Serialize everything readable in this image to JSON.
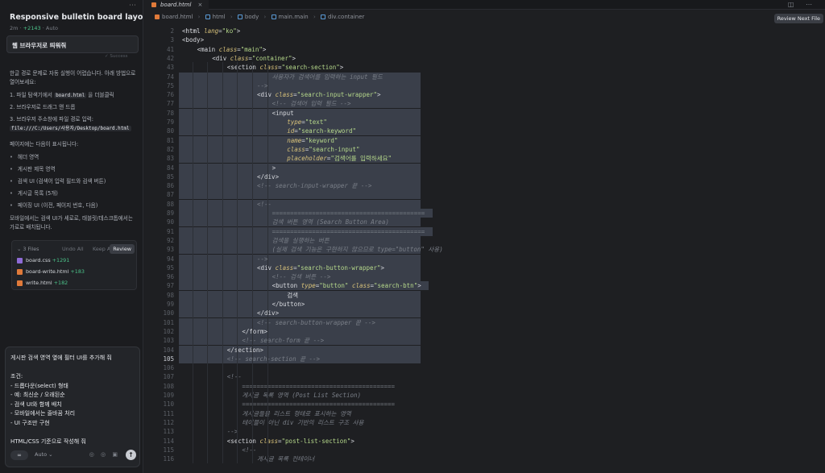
{
  "chat": {
    "title": "Responsive bulletin board layout",
    "meta_time": "2m",
    "meta_added": "+2143",
    "meta_mode": "Auto",
    "user_message": "웹 브라우저로 띄워줘",
    "success_label": "Success",
    "para1": "한글 경로 문제로 자동 실행이 어렵습니다. 아래 방법으로 열어보세요:",
    "steps": [
      {
        "num": "1.",
        "pre": "파일 탐색기에서 ",
        "code": "board.html",
        "post": " 을 더블클릭"
      },
      {
        "num": "2.",
        "pre": "브라우저로 드래그 앤 드롭",
        "code": "",
        "post": ""
      },
      {
        "num": "3.",
        "pre": "브라우저 주소창에 파일 경로 입력: ",
        "code": "file:///C:/Users/사용자/Desktop/board.html",
        "post": ""
      }
    ],
    "para2": "페이지에는 다음이 표시됩니다:",
    "bullets": [
      "헤더 영역",
      "게시판 제목 영역",
      "검색 UI (검색어 입력 필드와 검색 버튼)",
      "게시글 목록 (5개)",
      "페이징 UI (이전, 페이지 번호, 다음)"
    ],
    "para3": "모바일에서는 검색 UI가 세로로, 태블릿/데스크톱에서는 가로로 배치됩니다.",
    "files": {
      "count_label": "3 Files",
      "undo_all": "Undo All",
      "keep_all": "Keep All",
      "review": "Review",
      "items": [
        {
          "name": "board.css",
          "added": "+1291",
          "kind": "css"
        },
        {
          "name": "board-write.html",
          "added": "+183",
          "kind": "html"
        },
        {
          "name": "write.html",
          "added": "+182",
          "kind": "html"
        }
      ]
    },
    "composer_text": "게시판 검색 영역 옆에 필터 UI를 추가해 줘\n\n조건:\n- 드롭다운(select) 형태\n- 예: 최신순 / 오래된순\n- 검색 UI와 함께 배치\n- 모바일에서는 줄바꿈 처리\n- UI 구조만 구현\n\nHTML/CSS 기준으로 작성해 줘",
    "composer_mode": "∞",
    "composer_auto": "Auto ⌄",
    "composer_icons": "◎ ◎ ▣",
    "composer_send": "↑"
  },
  "editor": {
    "tab_name": "board.html",
    "tab_close": "×",
    "tab_actions": "◫ ⋯",
    "breadcrumb": [
      "board.html",
      "html",
      "body",
      "main.main",
      "div.container"
    ],
    "review_next": "Review Next File",
    "current_line": "105"
  },
  "code_lines": [
    {
      "n": "2",
      "i": 0,
      "hl": false,
      "parts": [
        [
          "t",
          "<"
        ],
        [
          "tag",
          "html"
        ],
        [
          "t",
          " "
        ],
        [
          "attr",
          "lang"
        ],
        [
          "t",
          "="
        ],
        [
          "str",
          "\"ko\""
        ],
        [
          "t",
          ">"
        ]
      ]
    },
    {
      "n": "3",
      "i": 0,
      "hl": false,
      "parts": [
        [
          "t",
          "<body>"
        ]
      ]
    },
    {
      "n": "41",
      "i": 1,
      "hl": false,
      "parts": [
        [
          "t",
          "<main "
        ],
        [
          "attr",
          "class"
        ],
        [
          "t",
          "="
        ],
        [
          "str",
          "\"main\""
        ],
        [
          "t",
          ">"
        ]
      ]
    },
    {
      "n": "42",
      "i": 2,
      "hl": false,
      "parts": [
        [
          "t",
          "<div "
        ],
        [
          "attr",
          "class"
        ],
        [
          "t",
          "="
        ],
        [
          "str",
          "\"container\""
        ],
        [
          "t",
          ">"
        ]
      ]
    },
    {
      "n": "43",
      "i": 3,
      "hl": false,
      "parts": [
        [
          "t",
          "<section "
        ],
        [
          "attr",
          "class"
        ],
        [
          "t",
          "="
        ],
        [
          "str",
          "\"search-section\""
        ],
        [
          "t",
          ">"
        ]
      ]
    },
    {
      "n": "74",
      "i": 6,
      "hl": true,
      "parts": [
        [
          "cm",
          "사용자가 검색어를 입력하는 input 필드"
        ]
      ]
    },
    {
      "n": "75",
      "i": 5,
      "hl": true,
      "parts": [
        [
          "cm",
          "-->"
        ]
      ]
    },
    {
      "n": "76",
      "i": 5,
      "hl": true,
      "parts": [
        [
          "t",
          "<div "
        ],
        [
          "attr",
          "class"
        ],
        [
          "t",
          "="
        ],
        [
          "str",
          "\"search-input-wrapper\""
        ],
        [
          "t",
          ">"
        ]
      ]
    },
    {
      "n": "77",
      "i": 6,
      "hl": true,
      "parts": [
        [
          "cm",
          "<!-- 검색어 입력 필드 -->"
        ]
      ]
    },
    {
      "n": "78",
      "i": 6,
      "hl": true,
      "parts": [
        [
          "t",
          "<input"
        ]
      ]
    },
    {
      "n": "79",
      "i": 7,
      "hl": true,
      "parts": [
        [
          "attr",
          "type"
        ],
        [
          "t",
          "="
        ],
        [
          "str",
          "\"text\""
        ]
      ]
    },
    {
      "n": "80",
      "i": 7,
      "hl": true,
      "parts": [
        [
          "attr",
          "id"
        ],
        [
          "t",
          "="
        ],
        [
          "str",
          "\"search-keyword\""
        ]
      ]
    },
    {
      "n": "81",
      "i": 7,
      "hl": true,
      "parts": [
        [
          "attr",
          "name"
        ],
        [
          "t",
          "="
        ],
        [
          "str",
          "\"keyword\""
        ]
      ]
    },
    {
      "n": "82",
      "i": 7,
      "hl": true,
      "parts": [
        [
          "attr",
          "class"
        ],
        [
          "t",
          "="
        ],
        [
          "str",
          "\"search-input\""
        ]
      ]
    },
    {
      "n": "83",
      "i": 7,
      "hl": true,
      "parts": [
        [
          "attr",
          "placeholder"
        ],
        [
          "t",
          "="
        ],
        [
          "str",
          "\"검색어를 입력하세요\""
        ]
      ]
    },
    {
      "n": "84",
      "i": 6,
      "hl": true,
      "parts": [
        [
          "t",
          ">"
        ]
      ]
    },
    {
      "n": "85",
      "i": 5,
      "hl": true,
      "parts": [
        [
          "t",
          "</div>"
        ]
      ]
    },
    {
      "n": "86",
      "i": 5,
      "hl": true,
      "parts": [
        [
          "cm",
          "<!-- search-input-wrapper 끝 -->"
        ]
      ]
    },
    {
      "n": "87",
      "i": 5,
      "hl": true,
      "parts": [
        [
          "t",
          ""
        ]
      ]
    },
    {
      "n": "88",
      "i": 5,
      "hl": true,
      "parts": [
        [
          "cm",
          "<!--"
        ]
      ]
    },
    {
      "n": "89",
      "i": 6,
      "hl": true,
      "parts": [
        [
          "cm",
          "=========================================="
        ]
      ]
    },
    {
      "n": "90",
      "i": 6,
      "hl": true,
      "parts": [
        [
          "cm",
          "검색 버튼 영역 (Search Button Area)"
        ]
      ]
    },
    {
      "n": "91",
      "i": 6,
      "hl": true,
      "parts": [
        [
          "cm",
          "=========================================="
        ]
      ]
    },
    {
      "n": "92",
      "i": 6,
      "hl": true,
      "parts": [
        [
          "cm",
          "검색을 실행하는 버튼"
        ]
      ]
    },
    {
      "n": "93",
      "i": 6,
      "hl": true,
      "parts": [
        [
          "cm",
          "(실제 검색 기능은 구현하지 않으므로 type=\"button\" 사용)"
        ]
      ]
    },
    {
      "n": "94",
      "i": 5,
      "hl": true,
      "parts": [
        [
          "cm",
          "-->"
        ]
      ]
    },
    {
      "n": "95",
      "i": 5,
      "hl": true,
      "parts": [
        [
          "t",
          "<div "
        ],
        [
          "attr",
          "class"
        ],
        [
          "t",
          "="
        ],
        [
          "str",
          "\"search-button-wrapper\""
        ],
        [
          "t",
          ">"
        ]
      ]
    },
    {
      "n": "96",
      "i": 6,
      "hl": true,
      "parts": [
        [
          "cm",
          "<!-- 검색 버튼 -->"
        ]
      ]
    },
    {
      "n": "97",
      "i": 6,
      "hl": true,
      "parts": [
        [
          "t",
          "<button "
        ],
        [
          "attr",
          "type"
        ],
        [
          "t",
          "="
        ],
        [
          "str",
          "\"button\""
        ],
        [
          "t",
          " "
        ],
        [
          "attr",
          "class"
        ],
        [
          "t",
          "="
        ],
        [
          "str",
          "\"search-btn\""
        ],
        [
          "t",
          ">"
        ]
      ]
    },
    {
      "n": "98",
      "i": 7,
      "hl": true,
      "parts": [
        [
          "t",
          "검색"
        ]
      ]
    },
    {
      "n": "99",
      "i": 6,
      "hl": true,
      "parts": [
        [
          "t",
          "</button>"
        ]
      ]
    },
    {
      "n": "100",
      "i": 5,
      "hl": true,
      "parts": [
        [
          "t",
          "</div>"
        ]
      ]
    },
    {
      "n": "101",
      "i": 5,
      "hl": true,
      "parts": [
        [
          "cm",
          "<!-- search-button-wrapper 끝 -->"
        ]
      ]
    },
    {
      "n": "102",
      "i": 4,
      "hl": true,
      "parts": [
        [
          "t",
          "</form>"
        ]
      ]
    },
    {
      "n": "103",
      "i": 4,
      "hl": true,
      "parts": [
        [
          "cm",
          "<!-- search-form 끝 -->"
        ]
      ]
    },
    {
      "n": "104",
      "i": 3,
      "hl": true,
      "parts": [
        [
          "t",
          "</section>"
        ]
      ]
    },
    {
      "n": "105",
      "i": 3,
      "hl": true,
      "parts": [
        [
          "cm",
          "<!-- search-section 끝 -->"
        ]
      ]
    },
    {
      "n": "106",
      "i": 0,
      "hl": false,
      "parts": [
        [
          "t",
          ""
        ]
      ]
    },
    {
      "n": "107",
      "i": 3,
      "hl": false,
      "parts": [
        [
          "cm",
          "<!--"
        ]
      ]
    },
    {
      "n": "108",
      "i": 4,
      "hl": false,
      "parts": [
        [
          "cm",
          "=========================================="
        ]
      ]
    },
    {
      "n": "109",
      "i": 4,
      "hl": false,
      "parts": [
        [
          "cm",
          "게시글 목록 영역 (Post List Section)"
        ]
      ]
    },
    {
      "n": "110",
      "i": 4,
      "hl": false,
      "parts": [
        [
          "cm",
          "=========================================="
        ]
      ]
    },
    {
      "n": "111",
      "i": 4,
      "hl": false,
      "parts": [
        [
          "cm",
          "게시글들을 리스트 형태로 표시하는 영역"
        ]
      ]
    },
    {
      "n": "112",
      "i": 4,
      "hl": false,
      "parts": [
        [
          "cm",
          "테이블이 아닌 div 기반의 리스트 구조 사용"
        ]
      ]
    },
    {
      "n": "113",
      "i": 3,
      "hl": false,
      "parts": [
        [
          "cm",
          "-->"
        ]
      ]
    },
    {
      "n": "114",
      "i": 3,
      "hl": false,
      "parts": [
        [
          "t",
          "<section "
        ],
        [
          "attr",
          "class"
        ],
        [
          "t",
          "="
        ],
        [
          "str",
          "\"post-list-section\""
        ],
        [
          "t",
          ">"
        ]
      ]
    },
    {
      "n": "115",
      "i": 4,
      "hl": false,
      "parts": [
        [
          "cm",
          "<!--"
        ]
      ]
    },
    {
      "n": "116",
      "i": 5,
      "hl": false,
      "parts": [
        [
          "cm",
          "게시글 목록 컨테이너"
        ]
      ]
    }
  ]
}
